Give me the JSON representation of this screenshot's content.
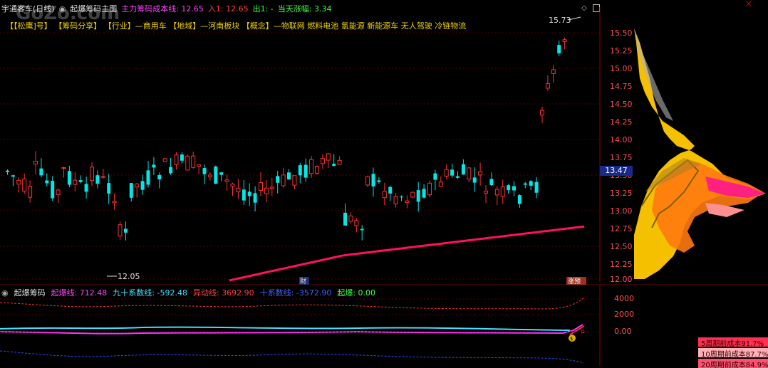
{
  "header": {
    "window_title": "宇通客车(日线)",
    "panel_title": "起爆筹码主图",
    "cost_label": "主力筹码成本线: 12.65",
    "in_label": "入1: 12.65",
    "out_label": "出1: -",
    "change_label": "当天涨幅: 3.34"
  },
  "sector_line": "【【松鹰]号】  【筹码分享】 【行业】—商用车 【地域】—河南板块 【概念】—物联网 燃料电池 氢能源 新能源车 无人驾驶 冷链物流",
  "watermark": "GoZo.com",
  "main_chart": {
    "price_axis": [
      "15.50",
      "15.25",
      "15.00",
      "14.75",
      "14.50",
      "14.25",
      "14.00",
      "13.75",
      "13.50",
      "13.25",
      "13.00",
      "12.75",
      "12.50",
      "12.25",
      "12.00"
    ],
    "current_price": "13.47",
    "high_label": "15.73",
    "low_label": "12.05",
    "marker_cai": "财",
    "marker_zhang": "涨预"
  },
  "indicator": {
    "title": "起爆筹码",
    "line1": "起爆线: 712.48",
    "line2": "九十系数线: -592.48",
    "line3": "异动线: 3692.90",
    "line4": "十系数线: -3572.90",
    "line5": "起爆: 0.00",
    "axis": [
      "4000",
      "2000",
      "0.00"
    ]
  },
  "stats": [
    {
      "label": "5周期前成本91.7%"
    },
    {
      "label": "10周期前成本87.7%"
    },
    {
      "label": "20周期前成本84.9%"
    }
  ],
  "colors": {
    "up": "#ff3030",
    "down": "#00e8e8",
    "magenta": "#ff00ff",
    "gold": "#f5c000",
    "orange": "#ff7a10"
  }
}
